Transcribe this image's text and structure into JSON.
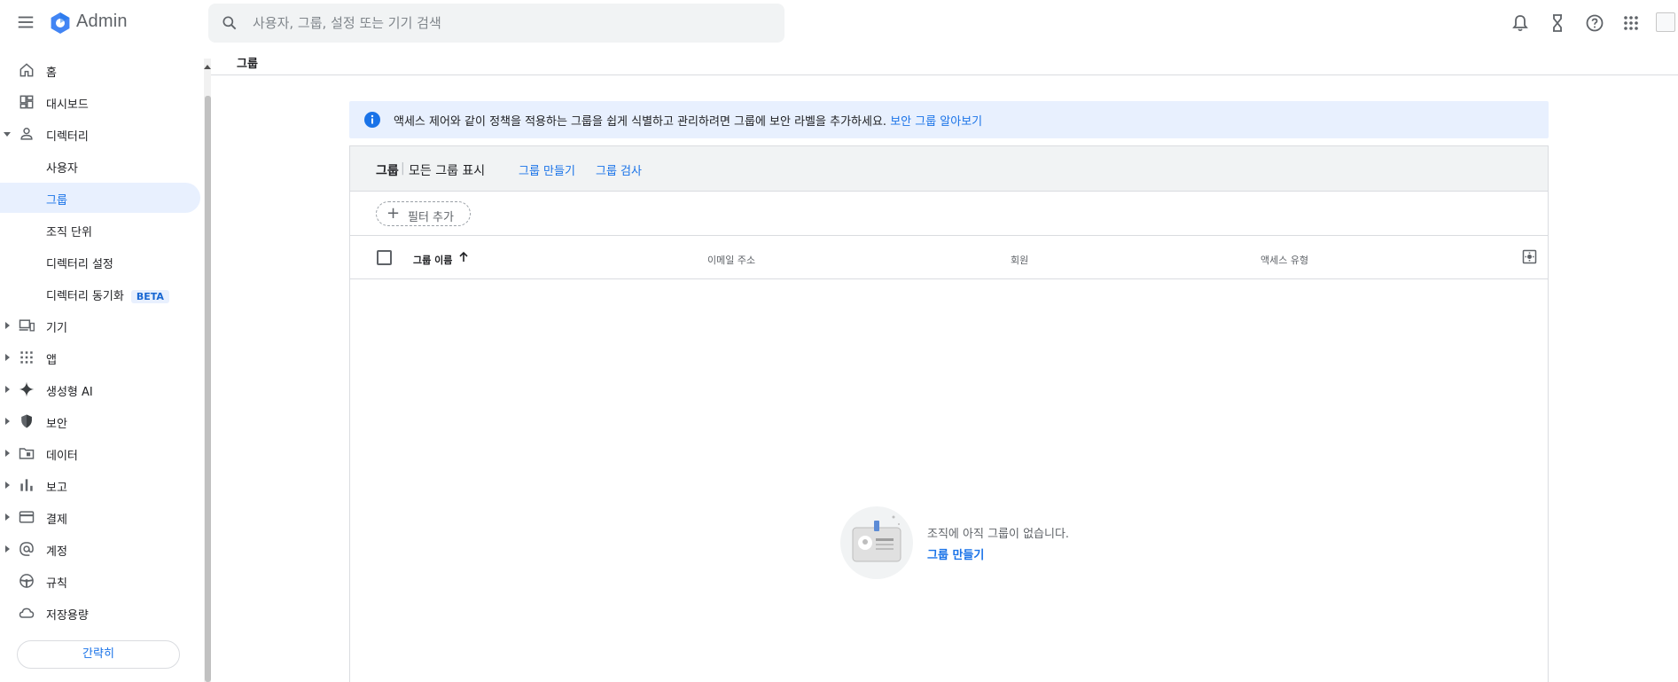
{
  "app": {
    "title": "Admin",
    "brand_color": "#1a73e8",
    "logo_color": "#4285f4"
  },
  "search": {
    "placeholder": "사용자, 그룹, 설정 또는 기기 검색",
    "value": ""
  },
  "top_icons": [
    "bell-icon",
    "hourglass-icon",
    "help-icon",
    "apps-grid-icon"
  ],
  "sidebar": {
    "items": [
      {
        "label": "홈",
        "icon": "home-icon"
      },
      {
        "label": "대시보드",
        "icon": "dashboard-icon"
      },
      {
        "label": "디렉터리",
        "icon": "person-icon",
        "expanded": true
      },
      {
        "label": "사용자"
      },
      {
        "label": "그룹",
        "active": true
      },
      {
        "label": "조직 단위"
      },
      {
        "label": "디렉터리 설정"
      },
      {
        "label": "디렉터리 동기화",
        "badge": "BETA"
      },
      {
        "label": "기기",
        "icon": "devices-icon"
      },
      {
        "label": "앱",
        "icon": "apps-icon"
      },
      {
        "label": "생성형 AI",
        "icon": "sparkle-icon"
      },
      {
        "label": "보안",
        "icon": "shield-icon"
      },
      {
        "label": "데이터",
        "icon": "folder-icon"
      },
      {
        "label": "보고",
        "icon": "bar-chart-icon"
      },
      {
        "label": "결제",
        "icon": "credit-card-icon"
      },
      {
        "label": "계정",
        "icon": "at-sign-icon"
      },
      {
        "label": "규칙",
        "icon": "steering-wheel-icon"
      },
      {
        "label": "저장용량",
        "icon": "cloud-icon"
      }
    ],
    "compact_label": "간략히"
  },
  "breadcrumb": "그룹",
  "banner": {
    "text": "액세스 제어와 같이 정책을 적용하는 그룹을 쉽게 식별하고 관리하려면 그룹에 보안 라벨을 추가하세요.",
    "link": "보안 그룹 알아보기"
  },
  "panel": {
    "title": "그룹",
    "subtitle": "모든 그룹 표시",
    "create_link": "그룹 만들기",
    "inspect_link": "그룹 검사",
    "filter_label": "필터 추가",
    "columns": [
      "그룹 이름",
      "이메일 주소",
      "회원",
      "액세스 유형"
    ],
    "empty_text": "조직에 아직 그룹이 없습니다.",
    "empty_link": "그룹 만들기"
  }
}
